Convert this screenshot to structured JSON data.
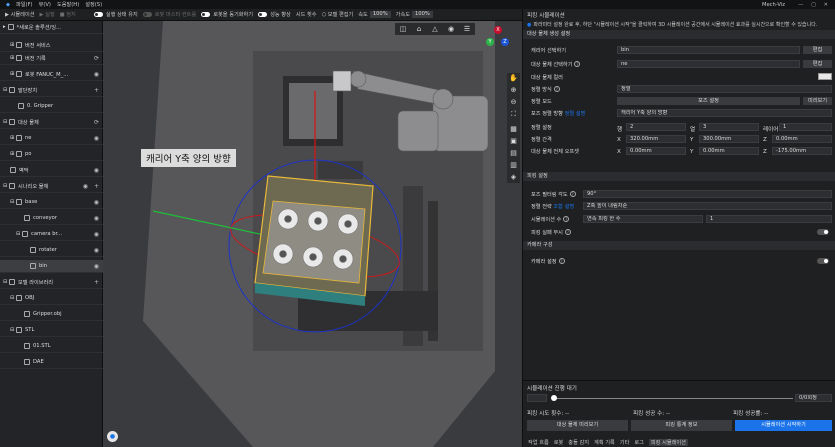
{
  "menubar": {
    "items": [
      "파일(F)",
      "뷰(V)",
      "도움말(H)",
      "설정(S)"
    ],
    "brand": "Mech-Viz",
    "window_controls": "— ▢ ✕"
  },
  "toolbar": {
    "simulate": "시뮬레이션",
    "run": "실행",
    "stop": "정지",
    "keep_state": "실행 상태 유지",
    "robot_master": "로봇 마스터 컨트롤",
    "sync_robot": "로봇을 동기화하기",
    "improve_perf": "성능 향상",
    "speed_label": "시드 횟수",
    "view_model": "모델 편집기",
    "velocity": "속도",
    "velocity_pct": "100%",
    "accel": "가속도",
    "accel_pct": "100%"
  },
  "sidebar": {
    "project": "*새로운 솔루션/잉...",
    "items": [
      {
        "label": "버전 서비스"
      },
      {
        "label": "버전 기록"
      },
      {
        "label": "로봇 FANUC_M_..."
      },
      {
        "label": "말단장치"
      },
      {
        "label": "0. Gripper"
      },
      {
        "label": "대상 물체"
      },
      {
        "label": "ne"
      },
      {
        "label": "po"
      },
      {
        "label": "벽막"
      },
      {
        "label": "시나리오 물체"
      },
      {
        "label": "base"
      },
      {
        "label": "conveyor"
      },
      {
        "label": "camera br..."
      },
      {
        "label": "rotater"
      },
      {
        "label": "bin"
      },
      {
        "label": "모델 라이브러리"
      },
      {
        "label": "OBJ"
      },
      {
        "label": "Gripper.obj"
      },
      {
        "label": "STL"
      },
      {
        "label": "01.STL"
      },
      {
        "label": "DAE"
      }
    ]
  },
  "viewport": {
    "annotation": "캐리어 Y축 양의 방향",
    "gizmo": [
      "X",
      "Y",
      "Z"
    ]
  },
  "props": {
    "title": "피킹 시뮬레이션",
    "info": "파라미터 설정 완료 후, 하단 \"시뮬레이션 시작\"을 클릭하여 3D 시뮬레이션 공간에서 시뮬레이션 효과를 실시간으로 확인할 수 있습니다.",
    "sec1": "대상 물체 생성 설정",
    "carrier_label": "캐리어 선택하기",
    "carrier_value": "bin",
    "edit": "편집",
    "target_label": "대상 물체 선택하기",
    "target_value": "ne",
    "target_color_label": "대상 물체 컬러",
    "arrange_label": "정렬 방식",
    "arrange_value": "정렬",
    "arrange_mode_label": "정렬 모드",
    "pose_settings": "포즈 설정",
    "preview": "미리보기",
    "pose_dir_label": "포즈 정렬 방향",
    "pose_dir_hint": "정렬 설명",
    "pose_dir_value": "캐리어 Y축 양의 방향",
    "grid_label": "정렬 설정",
    "row": "행",
    "row_v": "2",
    "col": "열",
    "col_v": "3",
    "layer": "레이어",
    "layer_v": "1",
    "spacing_label": "정렬 간격",
    "sx": "X",
    "sx_v": "320.00mm",
    "sy": "Y",
    "sy_v": "300.00mm",
    "sz": "Z",
    "sz_v": "0.00mm",
    "offset_label": "대상 물체 전체 오프셋",
    "ox": "X",
    "ox_v": "0.00mm",
    "oy": "Y",
    "oy_v": "0.00mm",
    "oz": "Z",
    "oz_v": "-175.00mm",
    "sec2": "피킹 설정",
    "pose_filter_label": "포즈 필터링 각도",
    "pose_filter_v": "90°",
    "pick_strategy_label": "정렬 전략",
    "pick_strategy_hint": "조합 설명",
    "pick_strategy_v": "Z축 높이 내림차순",
    "sim_count_label": "시뮬레이션 수",
    "sim_count_mode": "연속 피킹 한 수",
    "sim_count_v": "1",
    "ignore_fail_label": "피킹 실패 무시",
    "sec3": "카메라 구성",
    "camera_label": "카메라 설정",
    "progress_label": "시뮬레이션 진행 대기",
    "progress_value": "0/0회정",
    "stats": {
      "pick_count": "피킹 시도 횟수: --",
      "pick_success": "피킹 성공 수: --",
      "pick_rate": "피킹 성공률: --"
    },
    "preview_btn": "대상 물체 미리보기",
    "stats_btn": "피킹 통계 정보",
    "start_btn": "시뮬레이션 시작하기",
    "tabs": [
      "작업 흐름",
      "로봇",
      "충돌 감지",
      "계획 기록",
      "기타",
      "로그",
      "피킹 시뮬레이션"
    ]
  },
  "colors": {
    "accent": "#1a73e8",
    "carrier": "#e8b83a",
    "ring_blue": "#1c33c8",
    "ring_red": "#c81c1c"
  }
}
